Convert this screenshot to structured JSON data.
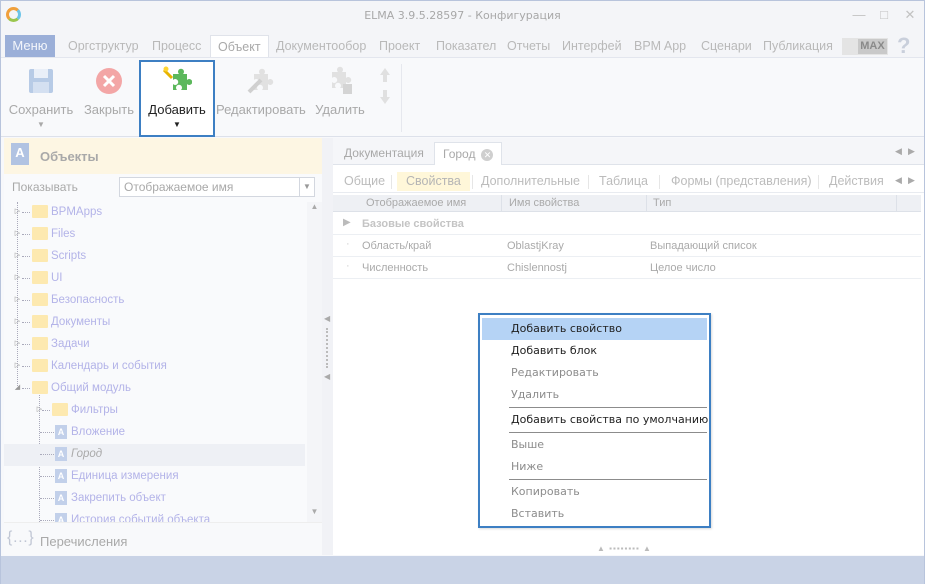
{
  "title": "ELMA 3.9.5.28597 - Конфигурация",
  "menu": {
    "menu_label": "Меню",
    "tabs": [
      "Оргструктур",
      "Процесс",
      "Объект",
      "Документообор",
      "Проект",
      "Показател",
      "Отчеты",
      "Интерфей",
      "BPM App",
      "Сценари",
      "Публикация"
    ],
    "active_tab": "Объект",
    "max_label": "MAX",
    "help_symbol": "?"
  },
  "ribbon": {
    "save": "Сохранить",
    "close": "Закрыть",
    "add": "Добавить",
    "edit": "Редактировать",
    "delete": "Удалить"
  },
  "left_panel": {
    "title": "Объекты",
    "show_label": "Показывать",
    "show_value": "Отображаемое имя",
    "tree": [
      {
        "label": "BPMApps",
        "type": "folder",
        "level": 0
      },
      {
        "label": "Files",
        "type": "folder",
        "level": 0
      },
      {
        "label": "Scripts",
        "type": "folder",
        "level": 0
      },
      {
        "label": "UI",
        "type": "folder",
        "level": 0
      },
      {
        "label": "Безопасность",
        "type": "folder",
        "level": 0
      },
      {
        "label": "Документы",
        "type": "folder",
        "level": 0
      },
      {
        "label": "Задачи",
        "type": "folder",
        "level": 0
      },
      {
        "label": "Календарь и события",
        "type": "folder",
        "level": 0
      },
      {
        "label": "Общий модуль",
        "type": "folder",
        "level": 0
      },
      {
        "label": "Фильтры",
        "type": "folder",
        "level": 1
      },
      {
        "label": "Вложение",
        "type": "object",
        "level": 1
      },
      {
        "label": "Город",
        "type": "object",
        "level": 1,
        "selected": true
      },
      {
        "label": "Единица измерения",
        "type": "object",
        "level": 1
      },
      {
        "label": "Закрепить объект",
        "type": "object",
        "level": 1
      },
      {
        "label": "История событий объекта",
        "type": "object",
        "level": 1
      }
    ],
    "enum_title": "Перечисления"
  },
  "doc_tabs": {
    "tabs": [
      "Документация",
      "Город"
    ],
    "active": "Город"
  },
  "sub_tabs": {
    "tabs": [
      "Общие",
      "Свойства",
      "Дополнительные",
      "Таблица",
      "Формы (представления)",
      "Действия"
    ],
    "active": "Свойства"
  },
  "grid": {
    "columns": [
      "Отображаемое имя",
      "Имя свойства",
      "Тип"
    ],
    "group_title": "Базовые свойства",
    "rows": [
      {
        "display": "Область/край",
        "name": "OblastjKray",
        "type": "Выпадающий список"
      },
      {
        "display": "Численность",
        "name": "Chislennostj",
        "type": "Целое число"
      }
    ]
  },
  "context_menu": {
    "items": [
      {
        "label": "Добавить свойство",
        "state": "hover"
      },
      {
        "label": "Добавить блок",
        "state": "enabled"
      },
      {
        "label": "Редактировать",
        "state": "disabled"
      },
      {
        "label": "Удалить",
        "state": "disabled"
      },
      {
        "label": "Добавить свойства по умолчанию",
        "state": "enabled"
      },
      {
        "label": "Выше",
        "state": "disabled"
      },
      {
        "label": "Ниже",
        "state": "disabled"
      },
      {
        "label": "Копировать",
        "state": "disabled"
      },
      {
        "label": "Вставить",
        "state": "disabled"
      }
    ]
  },
  "colors": {
    "highlight_border": "#3d7fc3",
    "menu_hover": "#b5d3f5",
    "menu_button": "#9bafd8"
  }
}
